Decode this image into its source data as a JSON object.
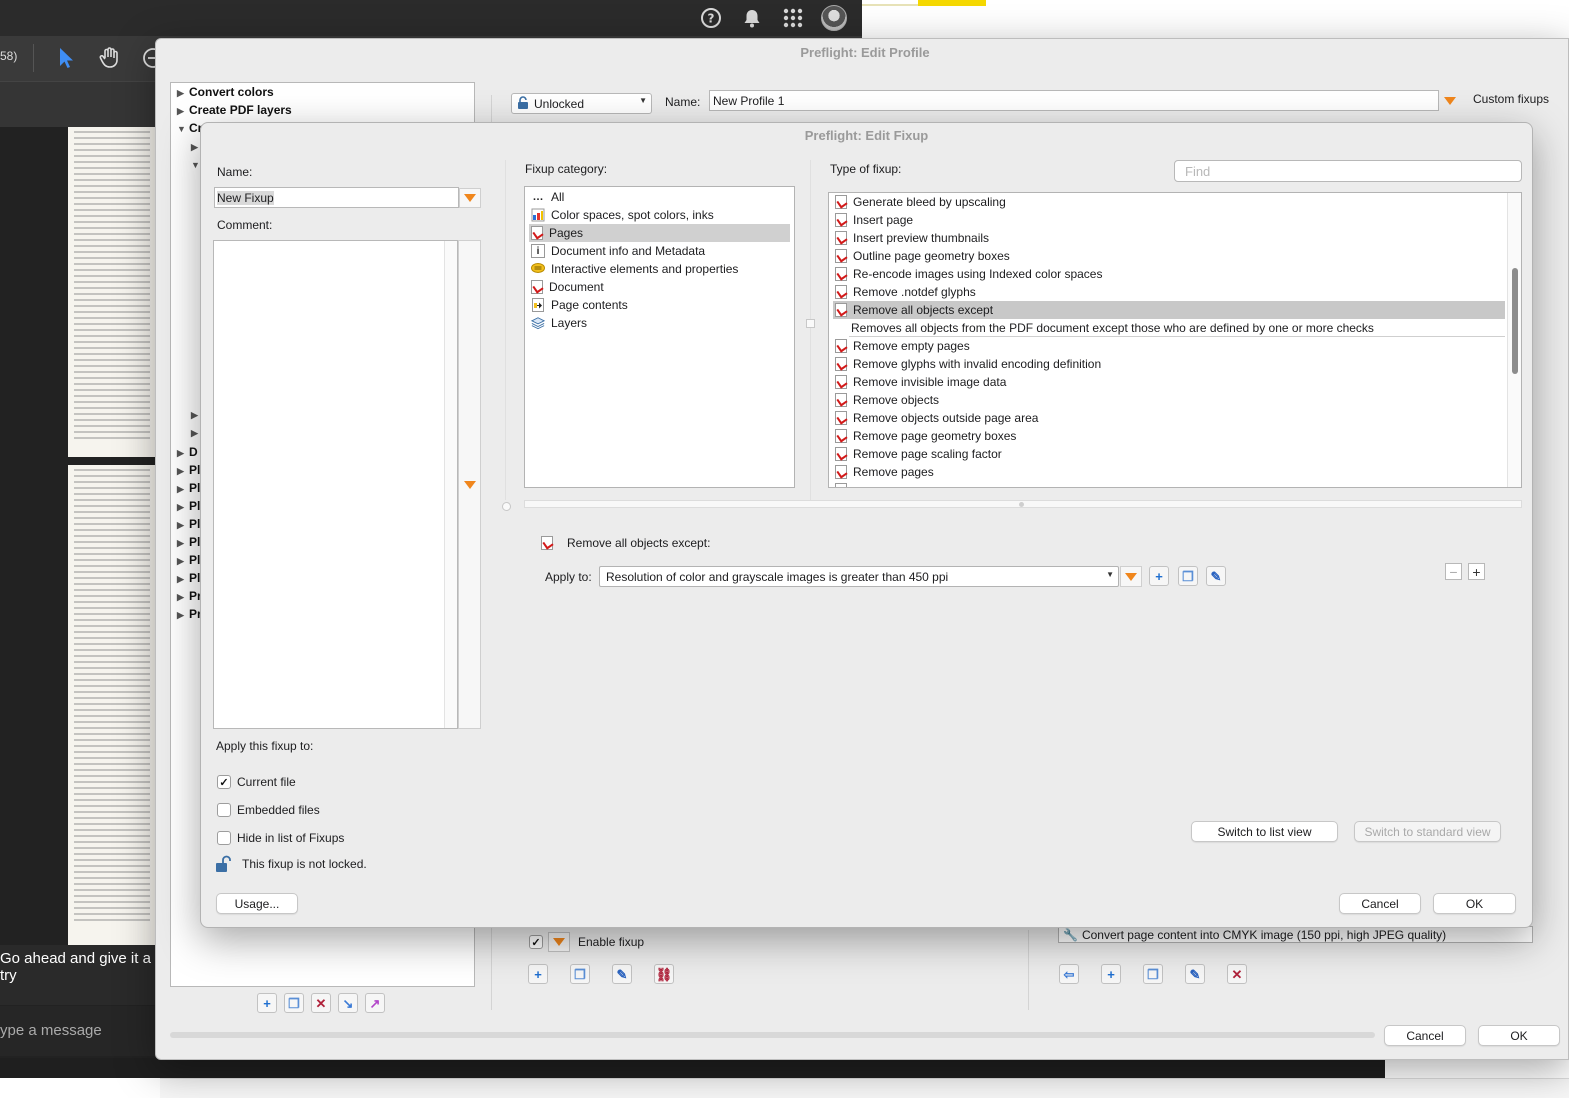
{
  "background": {
    "toolbar_partial_text": "58)",
    "chat_partial_text": "Go ahead and give it a try",
    "message_placeholder": "ype a message"
  },
  "profile_window": {
    "title": "Preflight: Edit Profile",
    "tree": {
      "items": [
        {
          "label": "Convert colors",
          "expanded": false
        },
        {
          "label": "Create PDF layers",
          "expanded": false
        },
        {
          "label": "Cr",
          "expanded": true
        },
        {
          "label": "D",
          "expanded": false
        },
        {
          "label": "Pl",
          "expanded": false
        },
        {
          "label": "Pl",
          "expanded": false
        },
        {
          "label": "Pl",
          "expanded": false
        },
        {
          "label": "Pl",
          "expanded": false
        },
        {
          "label": "Pl",
          "expanded": false
        },
        {
          "label": "Pl",
          "expanded": false
        },
        {
          "label": "Pl",
          "expanded": false
        },
        {
          "label": "Pr",
          "expanded": false
        },
        {
          "label": "Pr",
          "expanded": false
        }
      ]
    },
    "lock_select": "Unlocked",
    "name_label": "Name:",
    "name_value": "New Profile 1",
    "custom_fixups_label": "Custom fixups",
    "enable_fixup_label": "Enable fixup",
    "enable_fixup_checked": true,
    "fixup_list_item": "Convert page content into CMYK image (150 ppi, high JPEG quality)",
    "cancel_label": "Cancel",
    "ok_label": "OK"
  },
  "fixup_dialog": {
    "title": "Preflight: Edit Fixup",
    "name_label": "Name:",
    "name_value": "New Fixup",
    "comment_label": "Comment:",
    "comment_value": "",
    "apply_to_label": "Apply this fixup to:",
    "options": [
      {
        "label": "Current file",
        "checked": true
      },
      {
        "label": "Embedded files",
        "checked": false
      },
      {
        "label": "Hide in list of Fixups",
        "checked": false
      }
    ],
    "lock_status": "This fixup is not locked.",
    "usage_label": "Usage...",
    "category_label": "Fixup category:",
    "categories": [
      {
        "label": "All",
        "icon": "ellipsis-icon",
        "selected": false
      },
      {
        "label": "Color spaces, spot colors, inks",
        "icon": "color-spaces-icon",
        "selected": false
      },
      {
        "label": "Pages",
        "icon": "pdf-page-icon",
        "selected": true
      },
      {
        "label": "Document info and Metadata",
        "icon": "info-icon",
        "selected": false
      },
      {
        "label": "Interactive elements and properties",
        "icon": "comment-icon",
        "selected": false
      },
      {
        "label": "Document",
        "icon": "pdf-document-icon",
        "selected": false
      },
      {
        "label": "Page contents",
        "icon": "page-contents-icon",
        "selected": false
      },
      {
        "label": "Layers",
        "icon": "layers-icon",
        "selected": false
      }
    ],
    "type_label": "Type of fixup:",
    "find_placeholder": "Find",
    "fixup_types": [
      {
        "label": "Generate bleed by upscaling",
        "selected": false
      },
      {
        "label": "Insert page",
        "selected": false
      },
      {
        "label": "Insert preview thumbnails",
        "selected": false
      },
      {
        "label": "Outline page geometry boxes",
        "selected": false
      },
      {
        "label": "Re-encode images using Indexed color spaces",
        "selected": false
      },
      {
        "label": "Remove .notdef glyphs",
        "selected": false
      },
      {
        "label": "Remove all objects except",
        "selected": true
      },
      {
        "label": "Remove empty pages",
        "selected": false
      },
      {
        "label": "Remove glyphs with invalid encoding definition",
        "selected": false
      },
      {
        "label": "Remove invisible image data",
        "selected": false
      },
      {
        "label": "Remove objects",
        "selected": false
      },
      {
        "label": "Remove objects outside page area",
        "selected": false
      },
      {
        "label": "Remove page geometry boxes",
        "selected": false
      },
      {
        "label": "Remove page scaling factor",
        "selected": false
      },
      {
        "label": "Remove pages",
        "selected": false
      }
    ],
    "selected_description": "Removes all objects from the PDF document except those who are defined by one or more checks",
    "detail_title": "Remove all objects except:",
    "apply_to_field_label": "Apply to:",
    "apply_to_value": "Resolution of color and grayscale images is greater than 450 ppi",
    "switch_list_label": "Switch to list view",
    "switch_standard_label": "Switch to standard view",
    "cancel_label": "Cancel",
    "ok_label": "OK"
  }
}
